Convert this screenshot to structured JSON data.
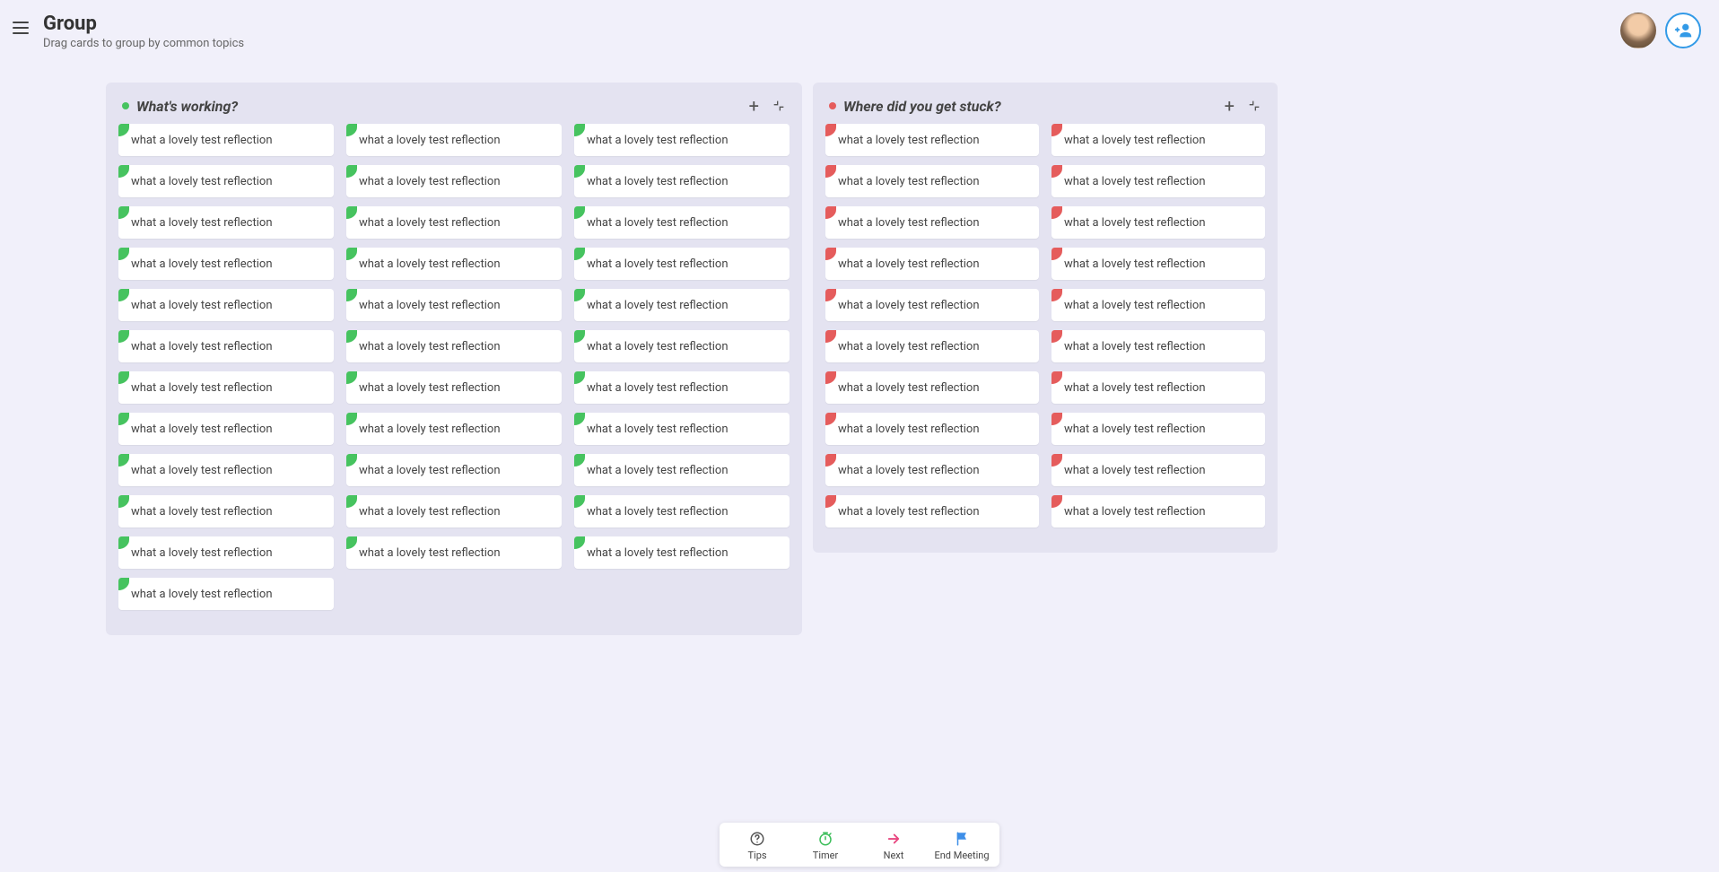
{
  "header": {
    "title": "Group",
    "subtitle": "Drag cards to group by common topics"
  },
  "columns": [
    {
      "id": "working",
      "title": "What's working?",
      "color": "green",
      "card_text": "what a lovely test reflection",
      "card_count": 34,
      "grid_cols": 3
    },
    {
      "id": "stuck",
      "title": "Where did you get stuck?",
      "color": "red",
      "card_text": "what a lovely test reflection",
      "card_count": 20,
      "grid_cols": 2
    }
  ],
  "toolbar": {
    "tips": "Tips",
    "timer": "Timer",
    "next": "Next",
    "end": "End Meeting"
  }
}
